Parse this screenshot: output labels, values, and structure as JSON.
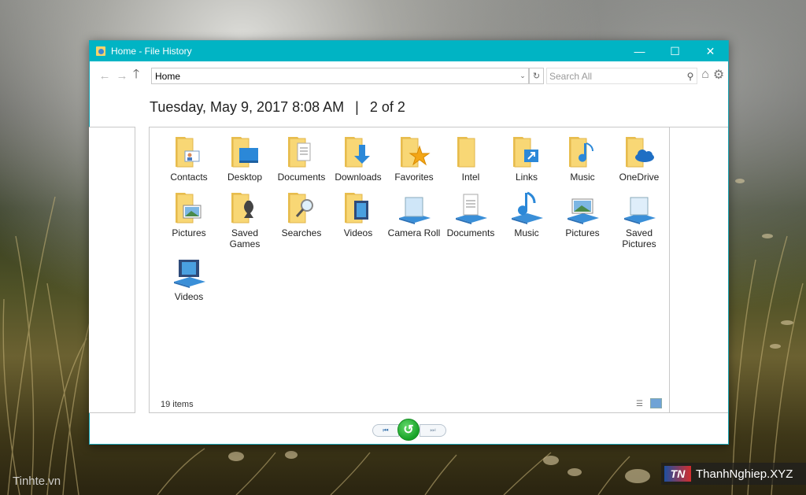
{
  "window": {
    "title": "Home - File History"
  },
  "titlebar": {
    "minimize": "—",
    "maximize": "☐",
    "close": "✕"
  },
  "nav": {
    "back_icon": "←",
    "forward_icon": "→",
    "up_icon": "🡑",
    "address": "Home",
    "dropdown_icon": "⌄",
    "refresh_icon": "↻",
    "search_placeholder": "Search All",
    "search_icon": "⚲",
    "home_icon": "⌂",
    "settings_icon": "⚙"
  },
  "header": {
    "date": "Tuesday, May 9, 2017 8:08 AM",
    "separator": "|",
    "position": "2 of 2"
  },
  "items": [
    {
      "label": "Contacts",
      "icon": "folder-contacts-icon"
    },
    {
      "label": "Desktop",
      "icon": "folder-desktop-icon"
    },
    {
      "label": "Documents",
      "icon": "folder-documents-icon"
    },
    {
      "label": "Downloads",
      "icon": "folder-downloads-icon"
    },
    {
      "label": "Favorites",
      "icon": "folder-favorites-icon"
    },
    {
      "label": "Intel",
      "icon": "folder-icon"
    },
    {
      "label": "Links",
      "icon": "folder-links-icon"
    },
    {
      "label": "Music",
      "icon": "folder-music-icon"
    },
    {
      "label": "OneDrive",
      "icon": "folder-onedrive-icon"
    },
    {
      "label": "Pictures",
      "icon": "folder-pictures-icon"
    },
    {
      "label": "Saved Games",
      "icon": "folder-saved-games-icon"
    },
    {
      "label": "Searches",
      "icon": "folder-searches-icon"
    },
    {
      "label": "Videos",
      "icon": "folder-videos-icon"
    },
    {
      "label": "Camera Roll",
      "icon": "library-camera-roll-icon"
    },
    {
      "label": "Documents",
      "icon": "library-documents-icon"
    },
    {
      "label": "Music",
      "icon": "library-music-icon"
    },
    {
      "label": "Pictures",
      "icon": "library-pictures-icon"
    },
    {
      "label": "Saved Pictures",
      "icon": "library-saved-pictures-icon"
    },
    {
      "label": "Videos",
      "icon": "library-videos-icon"
    }
  ],
  "status": {
    "count": "19 items"
  },
  "playback": {
    "previous_icon": "⏮",
    "restore_icon": "↺",
    "next_icon": "⏭"
  },
  "watermarks": {
    "left": "Tinhte.vn",
    "right_logo": "TN",
    "right": "ThanhNghiep.XYZ"
  },
  "colors": {
    "titlebar": "#00b4c4",
    "folder": "#f5d46b",
    "accent_blue": "#2b88d8",
    "restore_green": "#17a327"
  }
}
